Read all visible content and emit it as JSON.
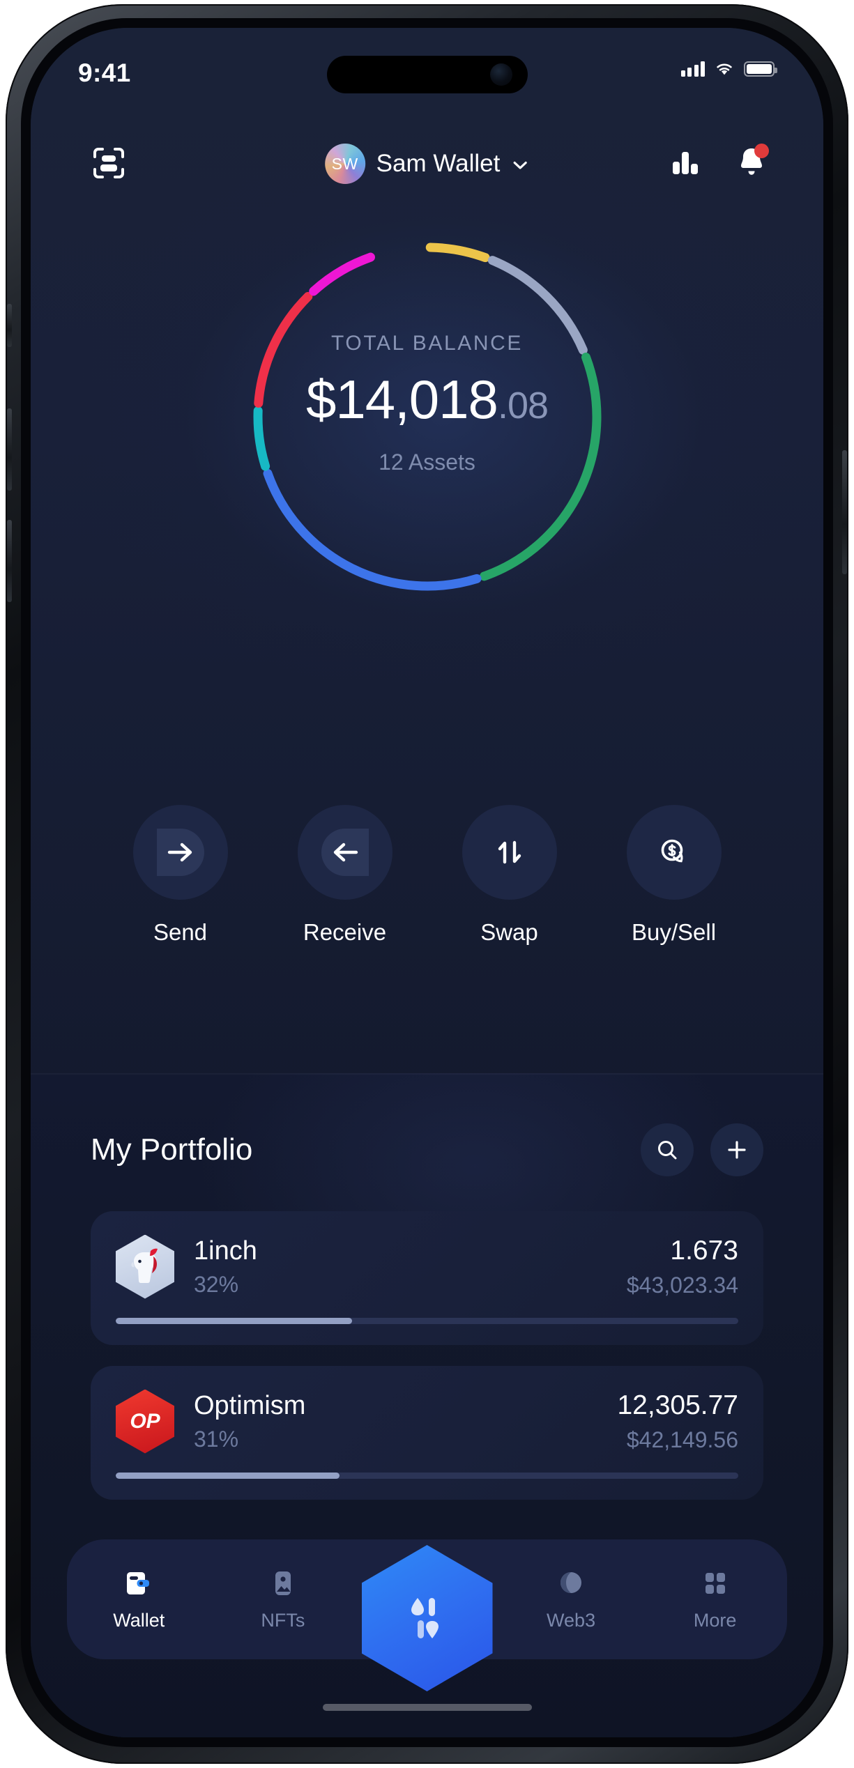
{
  "status_bar": {
    "time": "9:41",
    "signal_icon": "cellular-signal-icon",
    "wifi_icon": "wifi-icon",
    "battery_icon": "battery-full-icon"
  },
  "header": {
    "scan_icon": "scan-qr-icon",
    "avatar_initials": "SW",
    "wallet_name": "Sam Wallet",
    "chevron_icon": "chevron-down-icon",
    "stats_icon": "bar-chart-icon",
    "bell_icon": "bell-icon",
    "has_notification": true
  },
  "balance": {
    "label": "TOTAL BALANCE",
    "amount_main": "$14,018",
    "amount_cents": ".08",
    "assets_count": "12 Assets"
  },
  "ring": {
    "segments": [
      {
        "name": "slate",
        "color": "#9aa6c4",
        "percent": 13
      },
      {
        "name": "green",
        "color": "#27a567",
        "percent": 26
      },
      {
        "name": "blue",
        "color": "#3d74ea",
        "percent": 25
      },
      {
        "name": "teal",
        "color": "#17b9c4",
        "percent": 6
      },
      {
        "name": "red",
        "color": "#ef3049",
        "percent": 12
      },
      {
        "name": "magenta",
        "color": "#ee17d4",
        "percent": 7
      },
      {
        "name": "yellow",
        "color": "#edc martin",
        "percent": 6
      }
    ]
  },
  "actions": [
    {
      "label": "Send",
      "icon": "arrow-right-icon"
    },
    {
      "label": "Receive",
      "icon": "arrow-left-icon"
    },
    {
      "label": "Swap",
      "icon": "swap-arrows-icon"
    },
    {
      "label": "Buy/Sell",
      "icon": "dollar-coins-icon"
    }
  ],
  "portfolio": {
    "title": "My Portfolio",
    "search_icon": "search-icon",
    "add_icon": "plus-icon",
    "assets": [
      {
        "name": "1inch",
        "percent": "32%",
        "amount": "1.673",
        "usd_value": "$43,023.34",
        "bar_fill": 38,
        "logo": "1inch-unicorn-logo"
      },
      {
        "name": "Optimism",
        "percent": "31%",
        "amount": "12,305.77",
        "usd_value": "$42,149.56",
        "bar_fill": 36,
        "logo": "optimism-op-logo",
        "logo_text": "OP"
      }
    ]
  },
  "tabbar": {
    "items": [
      {
        "label": "Wallet",
        "icon": "wallet-icon",
        "active": true
      },
      {
        "label": "NFTs",
        "icon": "image-icon",
        "active": false
      },
      {
        "label": "Web3",
        "icon": "globe-icon",
        "active": false
      },
      {
        "label": "More",
        "icon": "grid-icon",
        "active": false
      }
    ],
    "fab_icon": "hexagon-drops-icon"
  },
  "colors": {
    "screen_bg": "#141a2e",
    "card_bg": "#1b2340",
    "accent_blue": "#2f6ef0",
    "muted_text": "#6d7a9e",
    "notification_red": "#e03b3b"
  }
}
